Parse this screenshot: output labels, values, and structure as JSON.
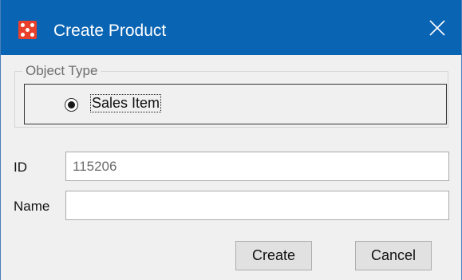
{
  "window": {
    "title": "Create Product",
    "accent_color": "#0a64b4",
    "icon": "app-logo-icon",
    "close_icon": "close-icon"
  },
  "object_type": {
    "legend": "Object Type",
    "options": [
      {
        "label": "Sales Item",
        "selected": true
      }
    ]
  },
  "fields": {
    "id": {
      "label": "ID",
      "value": "115206",
      "readonly": true
    },
    "name": {
      "label": "Name",
      "value": "",
      "placeholder": ""
    }
  },
  "buttons": {
    "create": "Create",
    "cancel": "Cancel"
  }
}
